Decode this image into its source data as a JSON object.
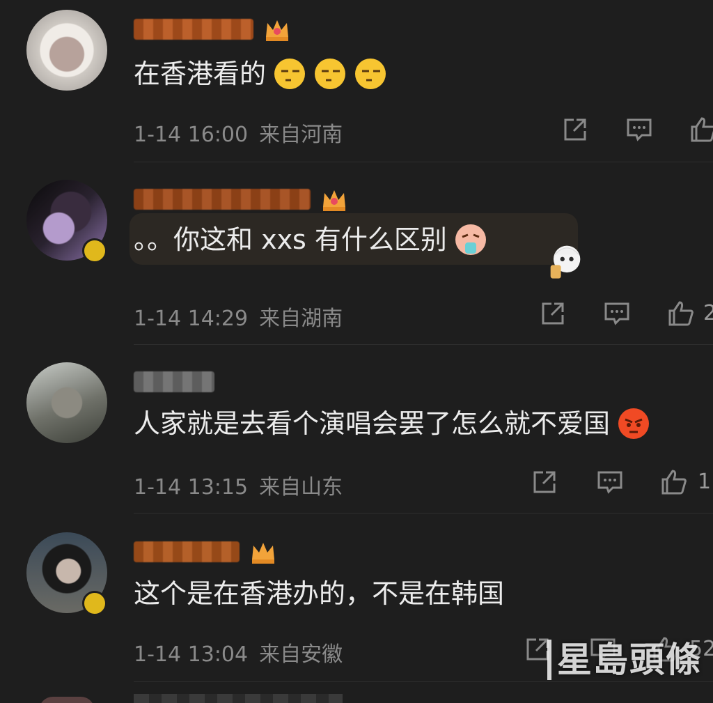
{
  "comments": [
    {
      "text": "在香港看的",
      "time": "1-14 16:00",
      "location": "来自河南",
      "like_count": "",
      "emoji_icon": "smirk-face-icon"
    },
    {
      "text": "。。你这和 xxs 有什么区别",
      "time": "1-14 14:29",
      "location": "来自湖南",
      "like_count": "2",
      "emoji_icon": "vomiting-face-icon"
    },
    {
      "text": "人家就是去看个演唱会罢了怎么就不爱国",
      "time": "1-14 13:15",
      "location": "来自山东",
      "like_count": "1",
      "emoji_icon": "angry-face-icon"
    },
    {
      "text": "这个是在香港办的，不是在韩国",
      "time": "1-14 13:04",
      "location": "来自安徽",
      "like_count": "52",
      "emoji_icon": ""
    }
  ],
  "watermark": "星島頭條",
  "colors": {
    "background": "#1e1e1e",
    "text": "#ececec",
    "meta": "#8a8a8a",
    "crown": "#f2a33a",
    "badge": "#e0b81c"
  }
}
